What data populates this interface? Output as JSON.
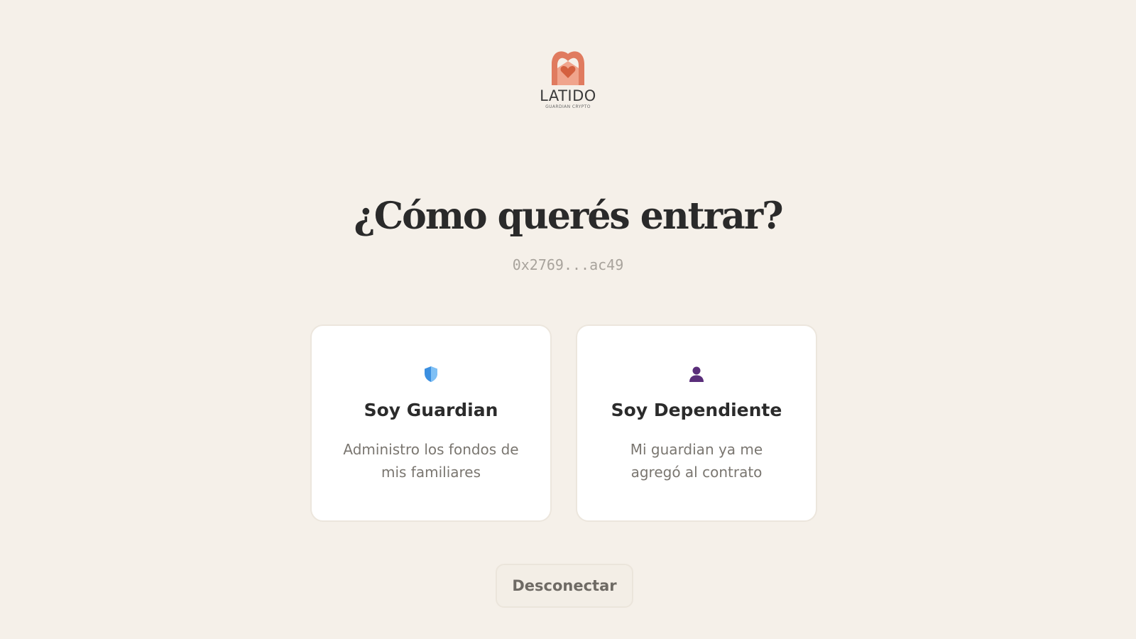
{
  "brand": {
    "name": "LATIDO",
    "tagline": "GUARDIAN CRYPTO",
    "logo_icon": "heart-house-icon",
    "colors": {
      "logo": "#e07b5f"
    }
  },
  "page": {
    "title": "¿Cómo querés entrar?",
    "wallet_address": "0x2769...ac49"
  },
  "roles": [
    {
      "icon": "shield-icon",
      "title": "Soy Guardian",
      "description": "Administro los fondos de mis familiares",
      "icon_color": "#3b8fe0"
    },
    {
      "icon": "person-icon",
      "title": "Soy Dependiente",
      "description": "Mi guardian ya me agregó al contrato",
      "icon_color": "#5a2e7a"
    }
  ],
  "actions": {
    "disconnect_label": "Desconectar"
  }
}
